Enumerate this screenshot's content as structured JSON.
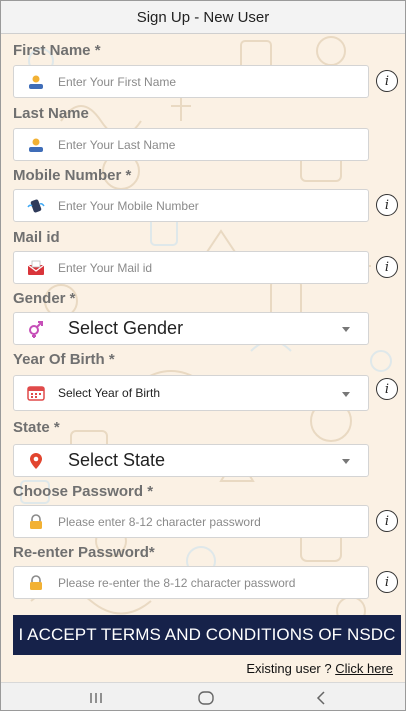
{
  "topbar": {
    "title": "Sign Up - New User"
  },
  "form": {
    "first_name": {
      "label": "First Name *",
      "placeholder": "Enter Your First Name"
    },
    "last_name": {
      "label": "Last Name",
      "placeholder": "Enter Your Last Name"
    },
    "mobile": {
      "label": "Mobile Number *",
      "placeholder": "Enter Your Mobile Number"
    },
    "mail": {
      "label": "Mail id",
      "placeholder": "Enter Your Mail id"
    },
    "gender": {
      "label": "Gender *",
      "value": "Select Gender"
    },
    "year_of_birth": {
      "label": "Year Of Birth *",
      "value": "Select Year of Birth"
    },
    "state": {
      "label": "State *",
      "value": "Select State"
    },
    "password": {
      "label": "Choose Password *",
      "placeholder": "Please enter 8-12 character password"
    },
    "reenter_password": {
      "label": "Re-enter Password*",
      "placeholder": "Please re-enter the 8-12 character password"
    },
    "info_glyph": "i"
  },
  "accept_button": {
    "label": "I ACCEPT TERMS AND CONDITIONS OF NSDC"
  },
  "existing_user": {
    "text": "Existing user ? ",
    "link": "Click here"
  },
  "navbar": {
    "recents_icon": "recents-icon",
    "home_icon": "home-icon",
    "back_icon": "back-icon"
  },
  "colors": {
    "button_bg": "#16224a",
    "background": "#fbf1e4",
    "label": "#707070"
  }
}
